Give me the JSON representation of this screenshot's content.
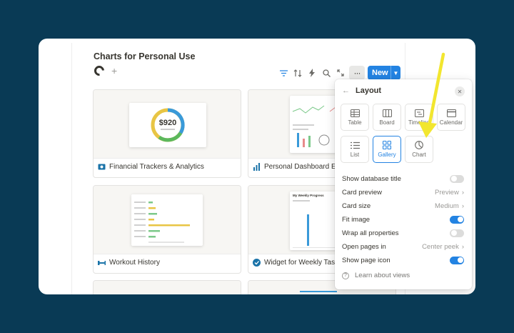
{
  "database": {
    "title": "Charts for Personal Use"
  },
  "toolbar": {
    "new_label": "New",
    "more_label": "···"
  },
  "cards": [
    {
      "title": "Financial Trackers & Analytics",
      "preview_value": "$920"
    },
    {
      "title": "Personal Dashboard Ex"
    },
    {
      "title": "Workout History"
    },
    {
      "title": "Widget for Weekly Task",
      "preview_heading": "My Weekly Progress"
    }
  ],
  "layout_panel": {
    "title": "Layout",
    "views": [
      {
        "label": "Table",
        "icon": "table-icon",
        "selected": false
      },
      {
        "label": "Board",
        "icon": "board-icon",
        "selected": false
      },
      {
        "label": "Timeline",
        "icon": "timeline-icon",
        "selected": false
      },
      {
        "label": "Calendar",
        "icon": "calendar-icon",
        "selected": false
      },
      {
        "label": "List",
        "icon": "list-icon",
        "selected": false
      },
      {
        "label": "Gallery",
        "icon": "gallery-icon",
        "selected": true
      },
      {
        "label": "Chart",
        "icon": "chart-icon",
        "selected": false
      }
    ],
    "settings": [
      {
        "label": "Show database title",
        "type": "toggle",
        "on": false
      },
      {
        "label": "Card preview",
        "type": "select",
        "value": "Preview"
      },
      {
        "label": "Card size",
        "type": "select",
        "value": "Medium"
      },
      {
        "label": "Fit image",
        "type": "toggle",
        "on": true
      },
      {
        "label": "Wrap all properties",
        "type": "toggle",
        "on": false
      },
      {
        "label": "Open pages in",
        "type": "select",
        "value": "Center peek"
      },
      {
        "label": "Show page icon",
        "type": "toggle",
        "on": true
      }
    ],
    "learn_label": "Learn about views"
  },
  "colors": {
    "background": "#093a55",
    "accent": "#2383e2",
    "annotation_arrow": "#f2e62f"
  }
}
